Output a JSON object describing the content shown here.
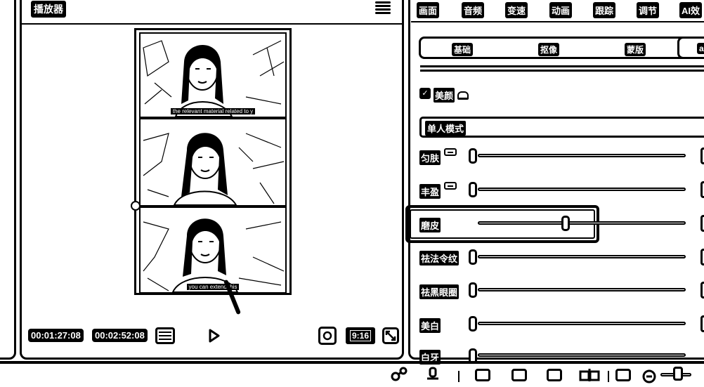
{
  "player": {
    "title": "播放器",
    "current_time": "00:01:27:08",
    "total_time": "00:02:52:08",
    "ratio": "9:16",
    "captions": [
      "the relevant material related to y",
      "you can extend this"
    ]
  },
  "right_panel": {
    "tabs": [
      "画面",
      "音频",
      "变速",
      "动画",
      "跟踪",
      "调节",
      "AI效"
    ],
    "sub_tabs": [
      "基础",
      "抠像",
      "蒙版",
      "a"
    ],
    "beauty": {
      "label": "美颜",
      "checked": true
    },
    "mode": "单人模式",
    "sliders": [
      {
        "label": "匀肤",
        "vip": true,
        "value": 0
      },
      {
        "label": "丰盈",
        "vip": true,
        "value": 0
      },
      {
        "label": "磨皮",
        "vip": false,
        "value": 0.44
      },
      {
        "label": "祛法令纹",
        "vip": false,
        "value": 0
      },
      {
        "label": "祛黑眼圈",
        "vip": false,
        "value": 0
      },
      {
        "label": "美白",
        "vip": false,
        "value": 0
      },
      {
        "label": "白牙",
        "vip": false,
        "value": 0
      }
    ]
  },
  "icons": {
    "menu": "hamburger-menu-icon",
    "play": "play-icon",
    "fit": "fit-screen-icon",
    "fullscreen": "fullscreen-icon",
    "cloud": "cloud-icon"
  }
}
